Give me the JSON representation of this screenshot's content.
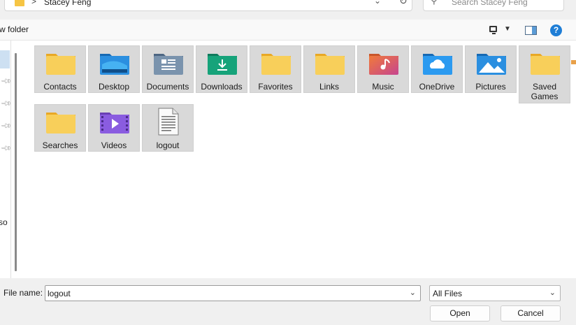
{
  "breadcrumb": {
    "separator": ">",
    "current": "Stacey Feng"
  },
  "search": {
    "placeholder": "Search Stacey Feng"
  },
  "toolbar": {
    "new_folder": "w folder",
    "help": "?"
  },
  "nav": {
    "truncated_label": "rso"
  },
  "items": [
    {
      "label": "Contacts",
      "icon": "contacts-folder-icon"
    },
    {
      "label": "Desktop",
      "icon": "desktop-folder-icon"
    },
    {
      "label": "Documents",
      "icon": "documents-folder-icon"
    },
    {
      "label": "Downloads",
      "icon": "downloads-folder-icon"
    },
    {
      "label": "Favorites",
      "icon": "favorites-folder-icon"
    },
    {
      "label": "Links",
      "icon": "links-folder-icon"
    },
    {
      "label": "Music",
      "icon": "music-folder-icon"
    },
    {
      "label": "OneDrive",
      "icon": "onedrive-folder-icon"
    },
    {
      "label": "Pictures",
      "icon": "pictures-folder-icon"
    },
    {
      "label": "Saved Games",
      "icon": "saved-games-folder-icon"
    },
    {
      "label": "Searches",
      "icon": "searches-folder-icon"
    },
    {
      "label": "Videos",
      "icon": "videos-folder-icon"
    },
    {
      "label": "logout",
      "icon": "text-file-icon"
    }
  ],
  "file_name": {
    "label": "File name:",
    "value": "logout"
  },
  "file_type": {
    "value": "All Files"
  },
  "buttons": {
    "open": "Open",
    "cancel": "Cancel"
  },
  "colors": {
    "folder": "#f6c544",
    "accent": "#1f7ed6",
    "tile_bg": "#d9d9d9"
  }
}
